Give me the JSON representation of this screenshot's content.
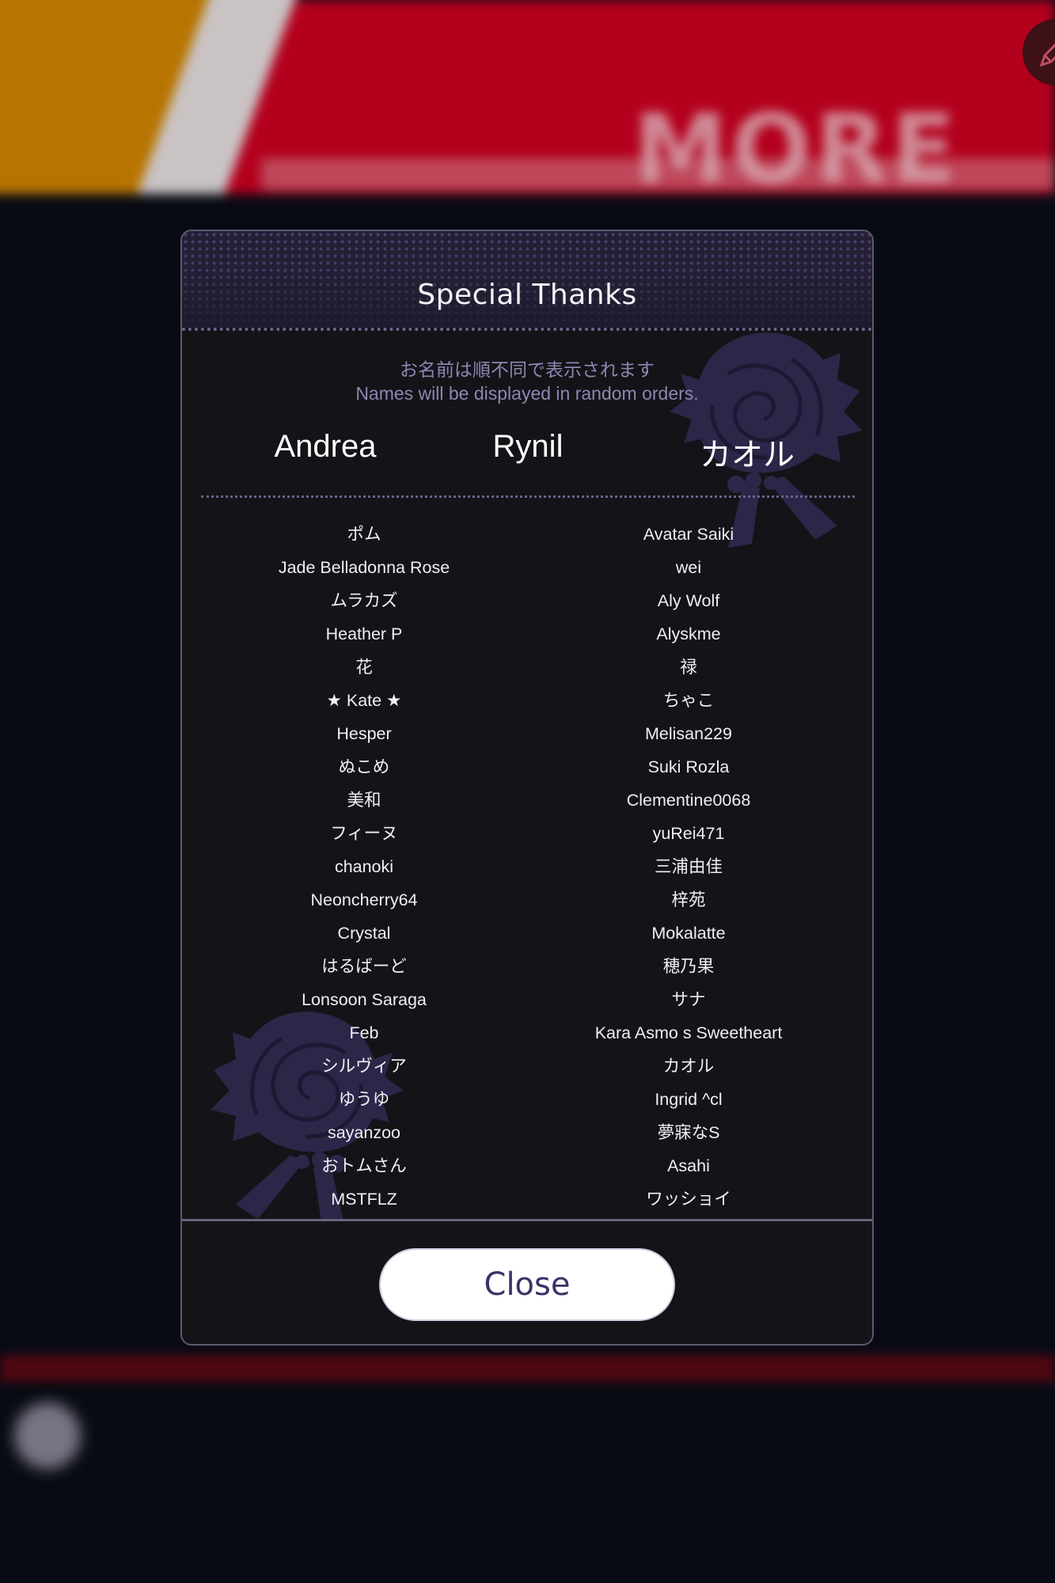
{
  "background": {
    "banner_word": "MORE"
  },
  "dialog": {
    "title": "Special Thanks",
    "notice_ja": "お名前は順不同で表示されます",
    "notice_en": "Names will be displayed in random orders.",
    "featured": [
      "Andrea",
      "Rynil",
      "カオル"
    ],
    "left_names": [
      "ポム",
      "Jade Belladonna Rose",
      "ムラカズ",
      "Heather P",
      "花",
      "★ Kate ★",
      "Hesper",
      "ぬこめ",
      "美和",
      "フィーヌ",
      "chanoki",
      "Neoncherry64",
      "Crystal",
      "はるばーど",
      "Lonsoon Saraga",
      "Feb",
      "シルヴィア",
      "ゆうゆ",
      "sayanzoo",
      "おトムさん",
      "MSTFLZ"
    ],
    "right_names": [
      "Avatar Saiki",
      "wei",
      "Aly Wolf",
      "Alyskme",
      "禄",
      "ちゃこ",
      "Melisan229",
      "Suki Rozla",
      "Clementine0068",
      "yuRei471",
      "三浦由佳",
      "梓苑",
      "Mokalatte",
      "穂乃果",
      "サナ",
      "Kara Asmo s Sweetheart",
      "カオル",
      "Ingrid ^cl",
      "夢寐なS",
      "Asahi",
      "ワッショイ"
    ],
    "close_label": "Close"
  },
  "colors": {
    "dialog_bg": "#141318",
    "accent_purple": "#8f86b2",
    "rose": "#2c2648",
    "banner_red": "#b3001d",
    "banner_orange": "#b87400"
  },
  "icons": {
    "fab": "pencil-icon",
    "decoration": "rose-icon"
  }
}
